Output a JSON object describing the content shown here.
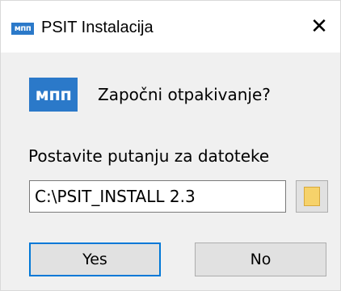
{
  "window": {
    "title": "PSIT Instalacija",
    "logo_text": "мпп",
    "close_glyph": "✕"
  },
  "dialog": {
    "logo_text": "мпп",
    "question": "Započni otpakivanje?",
    "path_label": "Postavite putanju za datoteke",
    "path_value": "C:\\PSIT_INSTALL 2.3"
  },
  "buttons": {
    "yes_label": "Yes",
    "no_label": "No"
  },
  "colors": {
    "brand_blue": "#2b79c9",
    "focus_border": "#0078d7",
    "folder_yellow": "#f6d26a"
  },
  "icons": {
    "browse": "folder-icon"
  }
}
